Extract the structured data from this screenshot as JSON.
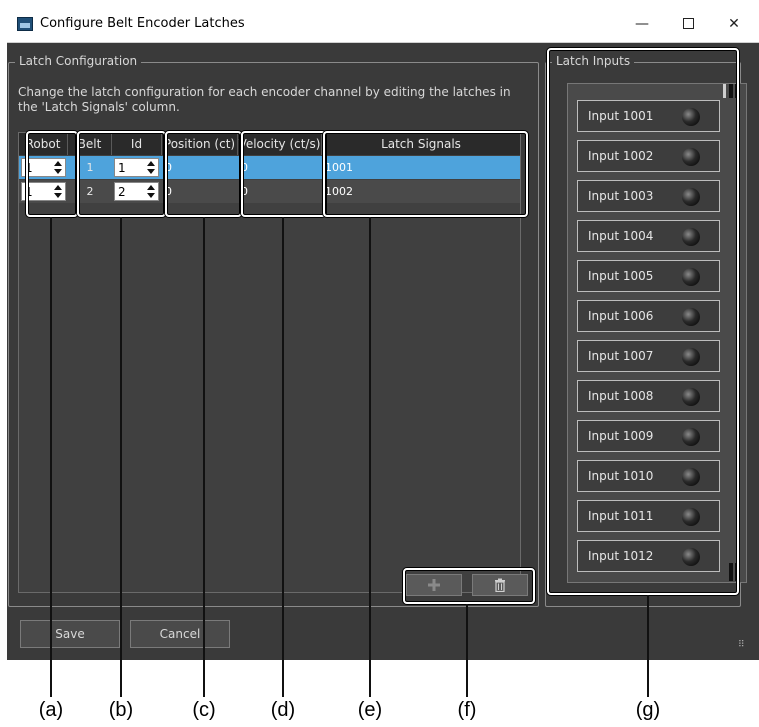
{
  "window": {
    "title": "Configure Belt Encoder Latches",
    "minimize_label": "—",
    "close_label": "✕"
  },
  "latch_config": {
    "legend": "Latch Configuration",
    "description": "Change the latch configuration for each encoder channel by editing the latches in the 'Latch Signals' column.",
    "columns": [
      "Robot",
      "Belt",
      "Id",
      "Position (ct)",
      "Velocity (ct/s)",
      "Latch Signals"
    ],
    "rows": [
      {
        "robot": "1",
        "belt": "1",
        "id": "1",
        "position": "0",
        "velocity": "0",
        "latch_signals": "1001",
        "selected": true
      },
      {
        "robot": "1",
        "belt": "2",
        "id": "2",
        "position": "0",
        "velocity": "0",
        "latch_signals": "1002",
        "selected": false
      }
    ],
    "add_icon": "plus-icon",
    "delete_icon": "trash-icon"
  },
  "latch_inputs": {
    "legend": "Latch Inputs",
    "items": [
      "Input 1001",
      "Input 1002",
      "Input 1003",
      "Input 1004",
      "Input 1005",
      "Input 1006",
      "Input 1007",
      "Input 1008",
      "Input 1009",
      "Input 1010",
      "Input 1011",
      "Input 1012"
    ]
  },
  "buttons": {
    "save": "Save",
    "cancel": "Cancel"
  },
  "callout_labels": [
    "(a)",
    "(b)",
    "(c)",
    "(d)",
    "(e)",
    "(f)",
    "(g)"
  ],
  "colors": {
    "window_bg": "#3a3a3a",
    "selected_row": "#4ea3dc",
    "header_bg": "#2a2a2a"
  }
}
